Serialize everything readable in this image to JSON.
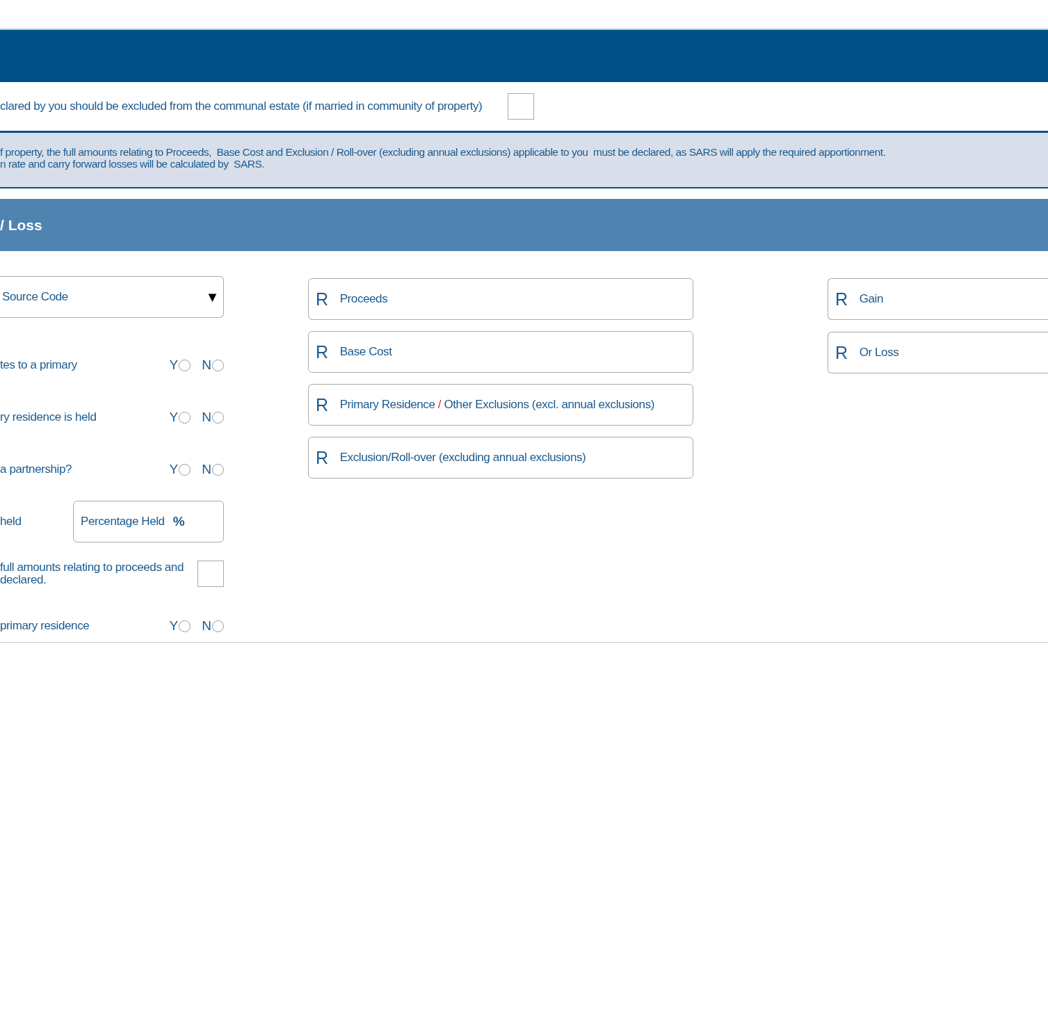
{
  "exclusion_row": {
    "label": "clared by you should be excluded from the communal estate (if married in community of property)",
    "checked": false
  },
  "notice": {
    "lines": [
      "f property, the full amounts relating to Proceeds,  Base Cost and Exclusion / Roll-over (excluding annual exclusions) applicable to you  must be declared, as SARS will apply the required apportionment.",
      "n rate and carry forward losses will be calculated by  SARS."
    ]
  },
  "section": {
    "title": "/ Loss"
  },
  "left_rows": [
    {
      "kind": "dropdown",
      "placeholder": "Source Code",
      "caret": "▼"
    },
    {
      "kind": "yesno",
      "label": "tes to a primary",
      "options": [
        {
          "label": "Y",
          "selected": false
        },
        {
          "label": "N",
          "selected": false
        }
      ]
    },
    {
      "kind": "yesno",
      "label": "ry residence is held",
      "options": [
        {
          "label": "Y",
          "selected": false
        },
        {
          "label": "N",
          "selected": false
        }
      ]
    },
    {
      "kind": "yesno",
      "label": "a partnership?",
      "options": [
        {
          "label": "Y",
          "selected": false
        },
        {
          "label": "N",
          "selected": false
        }
      ]
    },
    {
      "kind": "percentage",
      "label": "held",
      "placeholder": "Percentage Held",
      "unit": "%"
    },
    {
      "kind": "checkbox",
      "label": "full amounts relating to proceeds and\ndeclared.",
      "checked": false
    },
    {
      "kind": "yesno",
      "label": "primary residence",
      "options": [
        {
          "label": "Y",
          "selected": false
        },
        {
          "label": "N",
          "selected": false
        }
      ]
    }
  ],
  "amount_fields": [
    {
      "currency": "R",
      "label_parts": [
        {
          "kind": "plain",
          "text": "Proceeds"
        }
      ]
    },
    {
      "currency": "R",
      "label_parts": [
        {
          "kind": "plain",
          "text": "Base Cost"
        }
      ]
    },
    {
      "currency": "R",
      "label_parts": [
        {
          "kind": "plain",
          "text": "Primary Residence "
        },
        {
          "kind": "accent",
          "text": "/"
        },
        {
          "kind": "plain",
          "text": " Other Exclusions (excl. annual exclusions)"
        }
      ]
    },
    {
      "currency": "R",
      "label_parts": [
        {
          "kind": "plain",
          "text": "Exclusion/Roll-over (excluding annual exclusions)"
        }
      ]
    }
  ],
  "result_fields": [
    {
      "currency": "R",
      "label_parts": [
        {
          "kind": "plain",
          "text": "Gain"
        }
      ]
    },
    {
      "currency": "R",
      "label_parts": [
        {
          "kind": "plain",
          "text": "Or Loss"
        }
      ]
    }
  ]
}
